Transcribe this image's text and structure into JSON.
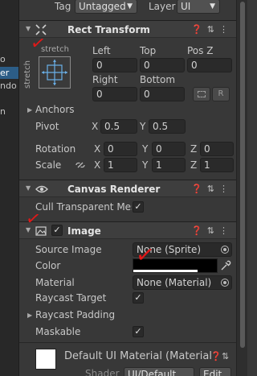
{
  "hierarchy": [
    {
      "text": "o",
      "selected": false
    },
    {
      "text": "er",
      "selected": true
    },
    {
      "text": "ndo",
      "selected": false
    },
    {
      "text": "n",
      "selected": false
    }
  ],
  "top": {
    "tag_label": "Tag",
    "tag_value": "Untagged",
    "layer_label": "Layer",
    "layer_value": "UI"
  },
  "rect_transform": {
    "title": "Rect Transform",
    "anchor_preset_top": "stretch",
    "anchor_preset_side": "stretch",
    "left_label": "Left",
    "left_value": "0",
    "top_label": "Top",
    "top_value": "0",
    "posz_label": "Pos Z",
    "posz_value": "0",
    "right_label": "Right",
    "right_value": "0",
    "bottom_label": "Bottom",
    "bottom_value": "0",
    "r_button": "R",
    "anchors_label": "Anchors",
    "pivot_label": "Pivot",
    "pivot_x_label": "X",
    "pivot_x": "0.5",
    "pivot_y_label": "Y",
    "pivot_y": "0.5",
    "rotation_label": "Rotation",
    "rot_x_label": "X",
    "rot_x": "0",
    "rot_y_label": "Y",
    "rot_y": "0",
    "rot_z_label": "Z",
    "rot_z": "0",
    "scale_label": "Scale",
    "scale_x_label": "X",
    "scale_x": "1",
    "scale_y_label": "Y",
    "scale_y": "1",
    "scale_z_label": "Z",
    "scale_z": "1"
  },
  "canvas_renderer": {
    "title": "Canvas Renderer",
    "cull_label": "Cull Transparent Mes",
    "cull_checked": "✓"
  },
  "image": {
    "title": "Image",
    "enabled": "✓",
    "source_image_label": "Source Image",
    "source_image_value": "None (Sprite)",
    "color_label": "Color",
    "color_value": "#000000",
    "material_label": "Material",
    "material_value": "None (Material)",
    "raycast_target_label": "Raycast Target",
    "raycast_target_checked": "✓",
    "raycast_padding_label": "Raycast Padding",
    "maskable_label": "Maskable",
    "maskable_checked": "✓"
  },
  "material_preview": {
    "name": "Default UI Material (Material",
    "shader_label": "Shader",
    "shader_value": "UI/Default",
    "edit_label": "Edit..."
  },
  "annotations": [
    "✓",
    "✓",
    "✓",
    "✓"
  ],
  "colors": {
    "accent_selection": "#2c5d87",
    "annotation": "#e01818"
  }
}
